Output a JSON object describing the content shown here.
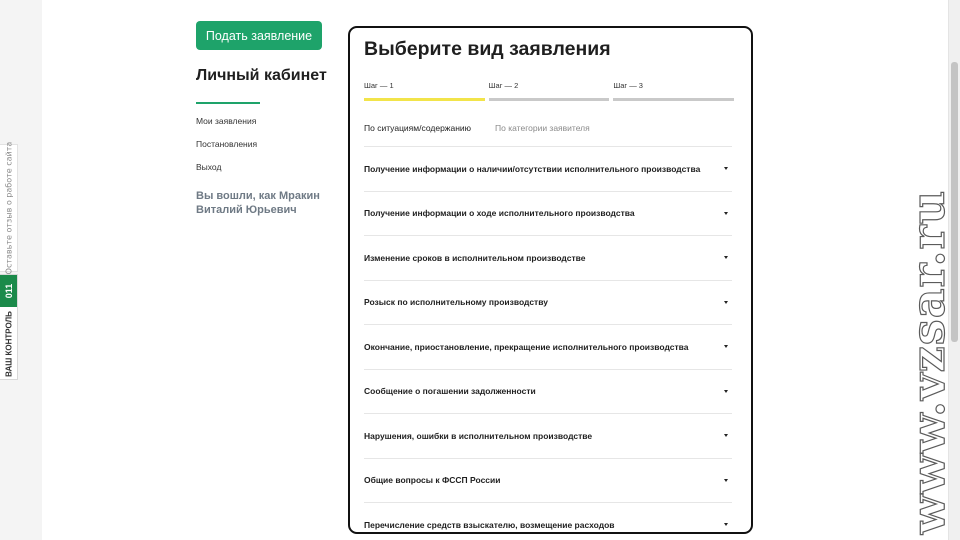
{
  "feedback_tab": {
    "label": "Оставьте отзыв о работе сайта"
  },
  "control_tab": {
    "number": "011",
    "label": "ВАШ КОНТРОЛЬ"
  },
  "sidebar": {
    "submit_label": "Подать заявление",
    "title": "Личный кабинет",
    "menu": [
      {
        "label": "Мои заявления"
      },
      {
        "label": "Постановления"
      },
      {
        "label": "Выход"
      }
    ],
    "logged_in": "Вы вошли, как Мракин Виталий Юрьевич"
  },
  "main": {
    "title": "Выберите вид заявления",
    "steps": [
      {
        "label": "Шаг — 1"
      },
      {
        "label": "Шаг — 2"
      },
      {
        "label": "Шаг — 3"
      }
    ],
    "tabs": [
      {
        "label": "По ситуациям/содержанию"
      },
      {
        "label": "По категории заявителя"
      }
    ],
    "items": [
      {
        "label": "Получение информации о наличии/отсутствии исполнительного производства"
      },
      {
        "label": "Получение информации о ходе исполнительного производства"
      },
      {
        "label": "Изменение сроков в исполнительном производстве"
      },
      {
        "label": "Розыск по исполнительному производству"
      },
      {
        "label": "Окончание, приостановление, прекращение исполнительного производства"
      },
      {
        "label": "Сообщение о погашении задолженности"
      },
      {
        "label": "Нарушения, ошибки в исполнительном производстве"
      },
      {
        "label": "Общие вопросы к ФССП России"
      },
      {
        "label": "Перечисление средств взыскателю, возмещение расходов"
      }
    ]
  },
  "watermark": "www.vzsar.ru",
  "colors": {
    "accent": "#1ea36a",
    "step_active": "#f2e44a",
    "step_inactive": "#c9c9c9",
    "control_green": "#1b8a4a",
    "panel_border": "#111111"
  }
}
